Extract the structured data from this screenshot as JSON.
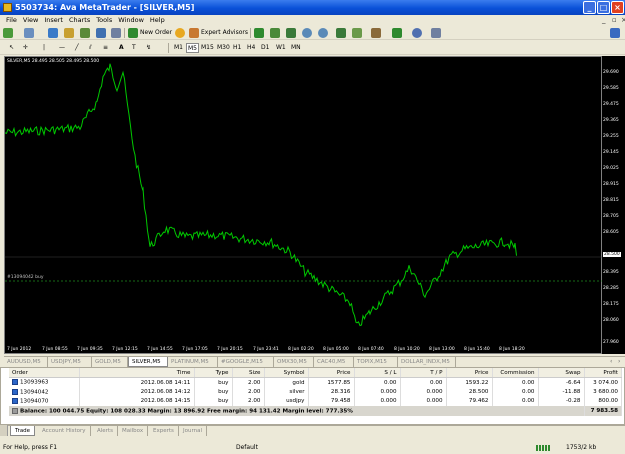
{
  "window": {
    "title": "5503734: Ava MetaTrader - [SILVER,M5]"
  },
  "menu": [
    "File",
    "View",
    "Insert",
    "Charts",
    "Tools",
    "Window",
    "Help"
  ],
  "toolbar": {
    "new_order": "New Order",
    "expert_advisors": "Expert Advisors",
    "timeframes": [
      "M1",
      "M5",
      "M15",
      "M30",
      "H1",
      "H4",
      "D1",
      "W1",
      "MN"
    ],
    "active_timeframe": "M5"
  },
  "chart": {
    "info": "SILVER,M5 28.495 28.505 28.495 28.500",
    "order_line_label": "#13094042 buy",
    "current_price": "28.500",
    "price_scale": [
      "29.690",
      "29.475",
      "29.255",
      "29.025",
      "28.815",
      "28.605",
      "28.395",
      "28.175",
      "27.960",
      "29.585",
      "29.365",
      "29.145",
      "28.915",
      "28.705",
      "28.500",
      "28.285",
      "28.060"
    ],
    "time_labels": [
      "7 Jun 2012",
      "7 Jun 08:55",
      "7 Jun 09:35",
      "7 Jun 12:15",
      "7 Jun 14:55",
      "7 Jun 17:05",
      "7 Jun 20:15",
      "7 Jun 23:41",
      "8 Jun 02:20",
      "8 Jun 05:00",
      "8 Jun 07:40",
      "8 Jun 10:20",
      "8 Jun 13:00",
      "8 Jun 15:40",
      "8 Jun 18:20"
    ]
  },
  "chart_tabs": [
    "AUDUSD,M5",
    "USDJPY,M5",
    "GOLD,M5",
    "SILVER,M5",
    "PLATINUM,M5",
    "#GOOGLE,M15",
    "OMX30,M5",
    "CAC40,M5",
    "TOPIX,M15",
    "DOLLAR_INDX,M5"
  ],
  "active_chart_tab": "SILVER,M5",
  "terminal": {
    "columns": [
      "Order",
      "Time",
      "Type",
      "Size",
      "Symbol",
      "Price",
      "S / L",
      "T / P",
      "Price",
      "Commission",
      "Swap",
      "Profit"
    ],
    "rows": [
      [
        "13093963",
        "2012.06.08 14:11",
        "buy",
        "2.00",
        "gold",
        "1577.85",
        "0.00",
        "0.00",
        "1593.22",
        "0.00",
        "-6.64",
        "3 074.00"
      ],
      [
        "13094042",
        "2012.06.08 14:12",
        "buy",
        "2.00",
        "silver",
        "28.316",
        "0.000",
        "0.000",
        "28.500",
        "0.00",
        "-11.88",
        "3 680.00"
      ],
      [
        "13094070",
        "2012.06.08 14:15",
        "buy",
        "2.00",
        "usdjpy",
        "79.458",
        "0.000",
        "0.000",
        "79.462",
        "0.00",
        "-0.28",
        "800.00"
      ]
    ],
    "balance": "Balance: 100 044.75  Equity: 108 028.33  Margin: 13 896.92  Free margin: 94 131.42  Margin level: 777.35%",
    "total_profit": "7 983.58",
    "tabs": [
      "Trade",
      "Account History",
      "Alerts",
      "Mailbox",
      "Experts",
      "Journal"
    ],
    "active_tab": "Trade"
  },
  "status": {
    "help": "For Help, press F1",
    "profile": "Default",
    "traffic": "1753/2 kb"
  }
}
